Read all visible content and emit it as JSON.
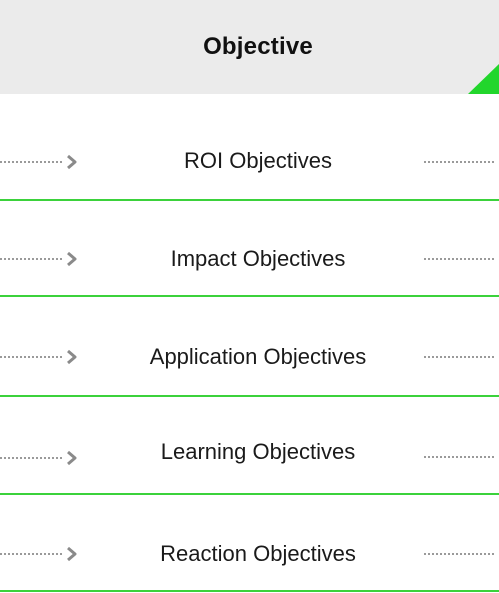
{
  "header": {
    "title": "Objective",
    "accent_color": "#22d62c",
    "background_color": "#ebebeb"
  },
  "rows": [
    {
      "label": "ROI Objectives"
    },
    {
      "label": "Impact Objectives"
    },
    {
      "label": "Application Objectives"
    },
    {
      "label": "Learning Objectives"
    },
    {
      "label": "Reaction Objectives"
    }
  ],
  "colors": {
    "divider": "#3bd23b",
    "dash": "#9a9a9a",
    "arrow": "#8a8a8a"
  },
  "icons": {
    "arrow": "chevron-right-icon"
  }
}
